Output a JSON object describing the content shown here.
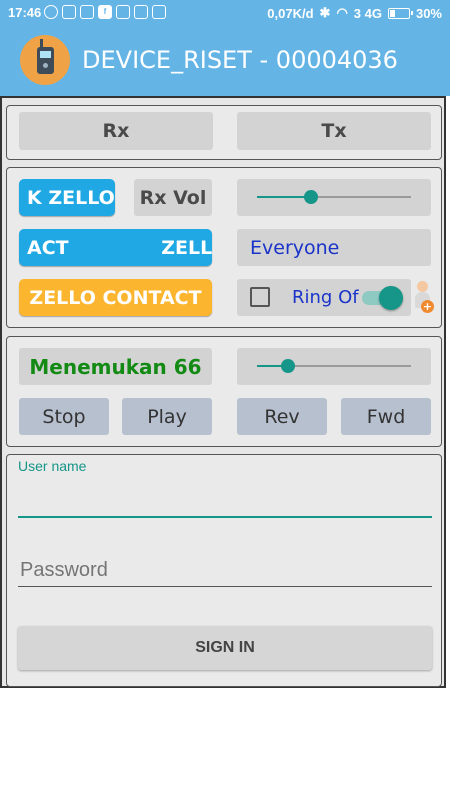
{
  "status_bar": {
    "time": "17:46",
    "notifications": [
      "whatsapp-icon",
      "phone-icon",
      "messenger-icon",
      "facebook-icon",
      "email-icon",
      "messenger-icon",
      "android-icon"
    ],
    "network_speed": "0,07K/d",
    "signal_text": "3 4G",
    "battery": "30%"
  },
  "app_bar": {
    "title": "DEVICE_RISET - 00004036",
    "color": "#64b5e6"
  },
  "tx_rx": {
    "rx_label": "Rx",
    "tx_label": "Tx"
  },
  "controls": {
    "zello_k_label": "K   ZELLO CONTACT",
    "rx_vol_label": "Rx Vol",
    "rx_vol_level": 0.35,
    "zello_act_label": "ACT              ZELLO W",
    "everyone_label": "Everyone",
    "zello_contact_label": "ZELLO CONTACT",
    "ring_label": "Ring Of",
    "ring_checked": false,
    "ring_toggle_on": true,
    "accent_blue": "#1fa8e3",
    "accent_orange": "#fbb52e"
  },
  "player": {
    "status_text": "Menemukan 66",
    "position_level": 0.2,
    "stop_label": "Stop",
    "play_label": "Play",
    "rev_label": "Rev",
    "fwd_label": "Fwd"
  },
  "login": {
    "username_label": "User name",
    "username_value": "",
    "password_placeholder": "Password",
    "sign_in_label": "SIGN IN"
  }
}
